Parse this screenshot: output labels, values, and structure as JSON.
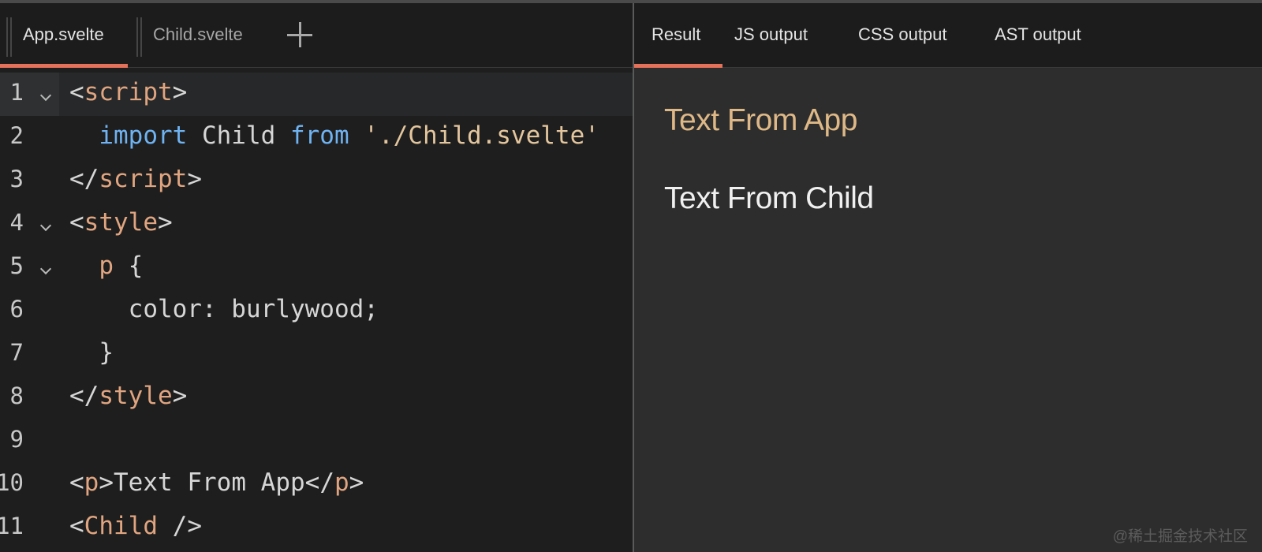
{
  "file_tabs": [
    {
      "label": "App.svelte",
      "active": true
    },
    {
      "label": "Child.svelte",
      "active": false
    }
  ],
  "add_tab_icon": "plus-icon",
  "output_tabs": [
    {
      "label": "Result",
      "active": true
    },
    {
      "label": "JS output",
      "active": false
    },
    {
      "label": "CSS output",
      "active": false
    },
    {
      "label": "AST output",
      "active": false
    }
  ],
  "editor": {
    "active_line": 1,
    "lines": [
      {
        "num": "1",
        "fold": true,
        "tokens": [
          [
            "punc",
            "<"
          ],
          [
            "tag",
            "script"
          ],
          [
            "punc",
            ">"
          ]
        ]
      },
      {
        "num": "2",
        "fold": false,
        "tokens": [
          [
            "txt",
            "  "
          ],
          [
            "kw",
            "import"
          ],
          [
            "txt",
            " Child "
          ],
          [
            "kw",
            "from"
          ],
          [
            "txt",
            " "
          ],
          [
            "str",
            "'./Child.svelte'"
          ]
        ]
      },
      {
        "num": "3",
        "fold": false,
        "tokens": [
          [
            "punc",
            "</"
          ],
          [
            "tag",
            "script"
          ],
          [
            "punc",
            ">"
          ]
        ]
      },
      {
        "num": "4",
        "fold": true,
        "tokens": [
          [
            "punc",
            "<"
          ],
          [
            "tag",
            "style"
          ],
          [
            "punc",
            ">"
          ]
        ]
      },
      {
        "num": "5",
        "fold": true,
        "tokens": [
          [
            "txt",
            "  "
          ],
          [
            "tag",
            "p"
          ],
          [
            "txt",
            " {"
          ]
        ]
      },
      {
        "num": "6",
        "fold": false,
        "tokens": [
          [
            "txt",
            "    color: burlywood;"
          ]
        ]
      },
      {
        "num": "7",
        "fold": false,
        "tokens": [
          [
            "txt",
            "  }"
          ]
        ]
      },
      {
        "num": "8",
        "fold": false,
        "tokens": [
          [
            "punc",
            "</"
          ],
          [
            "tag",
            "style"
          ],
          [
            "punc",
            ">"
          ]
        ]
      },
      {
        "num": "9",
        "fold": false,
        "tokens": []
      },
      {
        "num": "10",
        "fold": false,
        "tokens": [
          [
            "punc",
            "<"
          ],
          [
            "tag",
            "p"
          ],
          [
            "punc",
            ">"
          ],
          [
            "txt",
            "Text From App"
          ],
          [
            "punc",
            "</"
          ],
          [
            "tag",
            "p"
          ],
          [
            "punc",
            ">"
          ]
        ]
      },
      {
        "num": "11",
        "fold": false,
        "tokens": [
          [
            "punc",
            "<"
          ],
          [
            "tag",
            "Child"
          ],
          [
            "punc",
            " />"
          ]
        ]
      }
    ]
  },
  "preview": {
    "app_text": "Text From App",
    "child_text": "Text From Child",
    "app_text_color": "#deb887"
  },
  "watermark": "@稀土掘金技术社区",
  "colors": {
    "accent": "#e4715a",
    "keyword": "#6fb3f2",
    "tag": "#e0a580",
    "string": "#e3c69e"
  }
}
